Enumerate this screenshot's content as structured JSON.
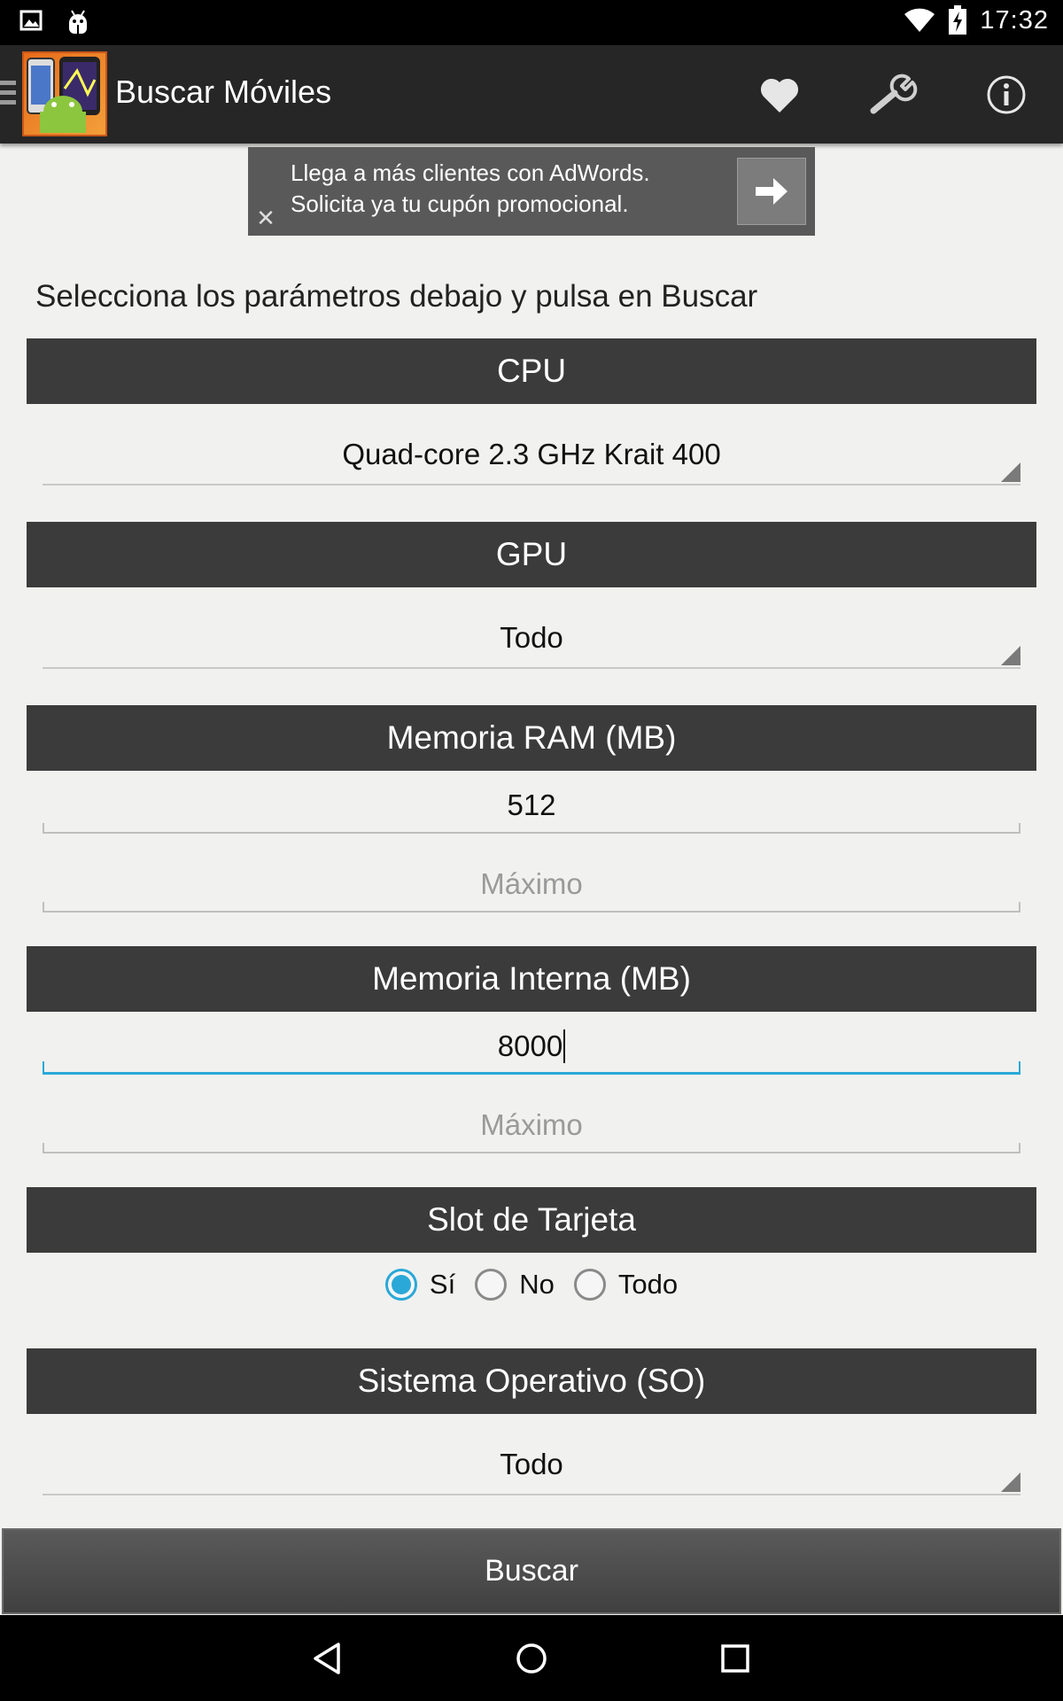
{
  "status_bar": {
    "time": "17:32",
    "icons": [
      "image-notification-icon",
      "android-debug-icon",
      "wifi-icon",
      "battery-charging-icon"
    ]
  },
  "action_bar": {
    "title": "Buscar Móviles",
    "icons": [
      "heart-icon",
      "wrench-icon",
      "info-icon"
    ]
  },
  "ad": {
    "line1": "Llega a más clientes con AdWords.",
    "line2": "Solicita ya tu cupón promocional."
  },
  "instruction": "Selecciona los parámetros debajo y pulsa en Buscar",
  "sections": {
    "cpu": {
      "header": "CPU",
      "value": "Quad-core 2.3 GHz Krait 400"
    },
    "gpu": {
      "header": "GPU",
      "value": "Todo"
    },
    "ram": {
      "header": "Memoria RAM (MB)",
      "min_value": "512",
      "max_placeholder": "Máximo"
    },
    "storage": {
      "header": "Memoria Interna (MB)",
      "min_value": "8000",
      "max_placeholder": "Máximo"
    },
    "card_slot": {
      "header": "Slot de Tarjeta",
      "options": [
        "Sí",
        "No",
        "Todo"
      ],
      "selected": "Sí"
    },
    "os": {
      "header": "Sistema Operativo (SO)",
      "value": "Todo"
    }
  },
  "search_button": "Buscar",
  "colors": {
    "accent": "#2aa8d8",
    "header_bg": "#3b3b3b",
    "action_bar_bg": "#262626",
    "page_bg": "#f1f1ef"
  }
}
